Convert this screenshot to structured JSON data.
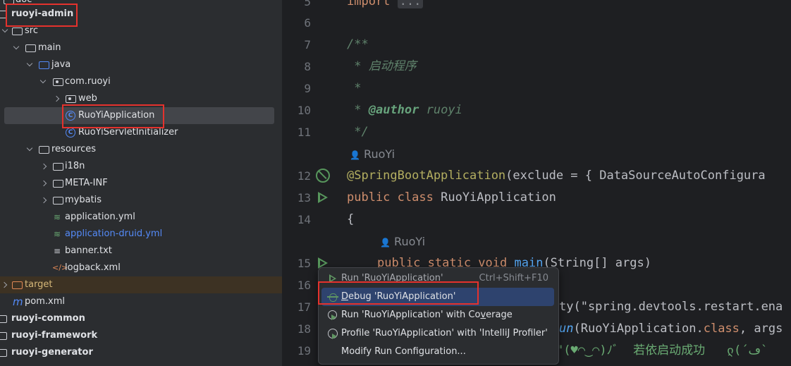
{
  "project_tree": {
    "top_cut_label": "doc",
    "items": [
      {
        "label": "ruoyi-admin"
      },
      {
        "label": "src"
      },
      {
        "label": "main"
      },
      {
        "label": "java"
      },
      {
        "label": "com.ruoyi"
      },
      {
        "label": "web"
      },
      {
        "label": "RuoYiApplication"
      },
      {
        "label": "RuoYiServletInitializer"
      },
      {
        "label": "resources"
      },
      {
        "label": "i18n"
      },
      {
        "label": "META-INF"
      },
      {
        "label": "mybatis"
      },
      {
        "label": "application.yml"
      },
      {
        "label": "application-druid.yml"
      },
      {
        "label": "banner.txt"
      },
      {
        "label": "logback.xml"
      },
      {
        "label": "target"
      },
      {
        "label": "pom.xml"
      },
      {
        "label": "ruoyi-common"
      },
      {
        "label": "ruoyi-framework"
      },
      {
        "label": "ruoyi-generator"
      }
    ]
  },
  "editor": {
    "line_numbers": [
      "5",
      "6",
      "7",
      "8",
      "9",
      "10",
      "11",
      "12",
      "13",
      "14",
      "15",
      "16",
      "17",
      "18",
      "19"
    ],
    "line5_kw": "import",
    "line5_fold": "...",
    "line7": "/**",
    "line8": " * 启动程序",
    "line9": " *",
    "line10_pre": " * ",
    "line10_tag": "@author",
    "line10_post": " ruoyi",
    "line11": " */",
    "author_hint_1": "RuoYi",
    "line12_ann": "@SpringBootApplication",
    "line12_rest": "(exclude = { DataSourceAutoConfigura",
    "line13_kw1": "public",
    "line13_kw2": "class",
    "line13_name": "RuoYiApplication",
    "line14": "{",
    "author_hint_2": "RuoYi",
    "line15_kw": "public static void",
    "line15_fn": "main",
    "line15_rest": "(String[] args)",
    "line17_visible": "ty(\"spring.devtools.restart.ena",
    "line18_fn": "un",
    "line18_rest": "(RuoYiApplication.",
    "line18_kw": "class",
    "line18_tail": ", args",
    "line19_str": "\"(♥◠‿◠)ﾉﾞ  若依启动成功   ლ(´ڡ`",
    "selection_color": "#2e436e",
    "highlight_color": "#e5322d"
  },
  "context_menu": {
    "items": [
      {
        "label": "Run 'RuoYiApplication'",
        "shortcut": "Ctrl+Shift+F10",
        "icon": "run-icon"
      },
      {
        "label_pre": "",
        "label_u": "D",
        "label_post": "ebug 'RuoYiApplication'",
        "icon": "debug-icon"
      },
      {
        "label_pre": "Run 'RuoYiApplication' with Co",
        "label_u": "v",
        "label_post": "erage",
        "icon": "coverage-icon"
      },
      {
        "label": "Profile 'RuoYiApplication' with 'IntelliJ Profiler'",
        "icon": "profiler-icon"
      },
      {
        "label": "Modify Run Configuration..."
      }
    ]
  }
}
